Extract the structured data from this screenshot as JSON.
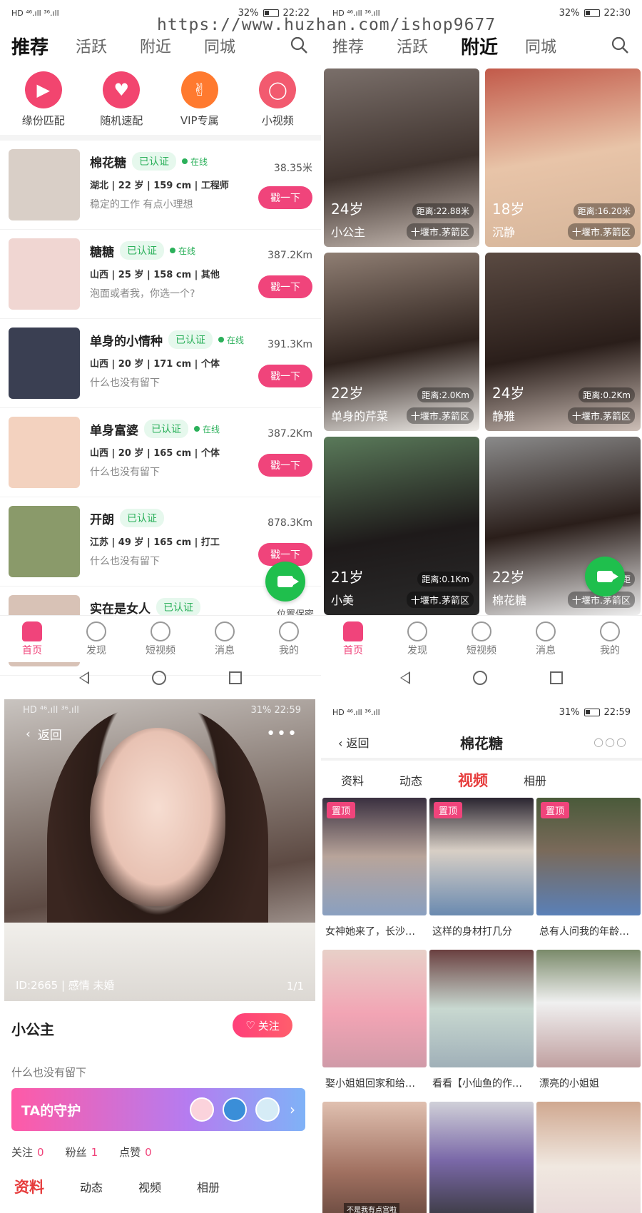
{
  "watermark": "https://www.huzhan.com/ishop9677",
  "colors": {
    "accent": "#f0447b",
    "online": "#2bb05a",
    "tab_active": "#e63c3c",
    "fab": "#1fbf4d"
  },
  "recommend": {
    "status": {
      "signal": "HD ⁴⁶.ıll ³⁶.ıll",
      "battery": "32%",
      "time": "22:22"
    },
    "tabs": [
      "推荐",
      "活跃",
      "附近",
      "同城"
    ],
    "active_tab": 0,
    "features": [
      {
        "label": "缘份匹配",
        "icon": "video-camera-icon",
        "color": "#f2456f"
      },
      {
        "label": "随机速配",
        "icon": "heart-target-icon",
        "color": "#f2456f"
      },
      {
        "label": "VIP专属",
        "icon": "thumbs-up-icon",
        "color": "#ff7a2f"
      },
      {
        "label": "小视频",
        "icon": "chat-bubble-icon",
        "color": "#f25a6f"
      }
    ],
    "users": [
      {
        "name": "棉花糖",
        "verified": "已认证",
        "online": "在线",
        "detail": "湖北 | 22 岁 | 159 cm | 工程师",
        "bio": "稳定的工作 有点小理想",
        "distance": "38.35米",
        "poke": "戳一下"
      },
      {
        "name": "糖糖",
        "verified": "已认证",
        "online": "在线",
        "detail": "山西 | 25 岁 | 158 cm | 其他",
        "bio": "泡面或者我，你选一个?",
        "distance": "387.2Km",
        "poke": "戳一下"
      },
      {
        "name": "单身的小情种",
        "verified": "已认证",
        "online": "在线",
        "detail": "山西 | 20 岁 | 171 cm | 个体",
        "bio": "什么也没有留下",
        "distance": "391.3Km",
        "poke": "戳一下"
      },
      {
        "name": "单身富婆",
        "verified": "已认证",
        "online": "在线",
        "detail": "山西 | 20 岁 | 165 cm | 个体",
        "bio": "什么也没有留下",
        "distance": "387.2Km",
        "poke": "戳一下"
      },
      {
        "name": "开朗",
        "verified": "已认证",
        "online": "",
        "detail": "江苏 | 49 岁 | 165 cm | 打工",
        "bio": "什么也没有留下",
        "distance": "878.3Km",
        "poke": "戳一下"
      },
      {
        "name": "实在是女人",
        "verified": "已认证",
        "online": "",
        "detail": "",
        "bio": "",
        "distance": "",
        "poke": ""
      }
    ],
    "location_note": "位置保密",
    "bottom_nav": [
      "首页",
      "发现",
      "短视频",
      "消息",
      "我的"
    ]
  },
  "nearby": {
    "status": {
      "signal": "HD ⁴⁶.ıll ³⁶.ıll",
      "battery": "32%",
      "time": "22:30"
    },
    "tabs": [
      "推荐",
      "活跃",
      "附近",
      "同城"
    ],
    "active_tab": 2,
    "cards": [
      {
        "age": "24岁",
        "distance": "距离:22.88米",
        "name": "小公主",
        "city": "十堰市.茅箭区"
      },
      {
        "age": "18岁",
        "distance": "距离:16.20米",
        "name": "沉静",
        "city": "十堰市.茅箭区"
      },
      {
        "age": "22岁",
        "distance": "距离:2.0Km",
        "name": "单身的芹菜",
        "city": "十堰市.茅箭区"
      },
      {
        "age": "24岁",
        "distance": "距离:0.2Km",
        "name": "静雅",
        "city": "十堰市.茅箭区"
      },
      {
        "age": "21岁",
        "distance": "距离:0.1Km",
        "name": "小美",
        "city": "十堰市.茅箭区"
      },
      {
        "age": "22岁",
        "distance": "距",
        "name": "棉花糖",
        "city": "十堰市.茅箭区"
      }
    ],
    "bottom_nav": [
      "首页",
      "发现",
      "短视频",
      "消息",
      "我的"
    ]
  },
  "profile": {
    "status": {
      "signal": "HD ⁴⁶.ıll ³⁶.ıll",
      "battery": "31%",
      "time": "22:59"
    },
    "back": "返回",
    "meta": "ID:2665 | 感情 未婚",
    "pager": "1/1",
    "name": "小公主",
    "follow": "关注",
    "bio": "什么也没有留下",
    "guard_title": "TA的守护",
    "stats": [
      {
        "label": "关注",
        "value": "0"
      },
      {
        "label": "粉丝",
        "value": "1"
      },
      {
        "label": "点赞",
        "value": "0"
      }
    ],
    "tabs": [
      "资料",
      "动态",
      "视频",
      "相册"
    ],
    "active_tab": 0
  },
  "videos": {
    "status": {
      "signal": "HD ⁴⁶.ıll ³⁶.ıll",
      "battery": "31%",
      "time": "22:59"
    },
    "back": "返回",
    "title": "棉花糖",
    "tabs": [
      "资料",
      "动态",
      "视频",
      "相册"
    ],
    "active_tab": 2,
    "items": [
      {
        "title": "女神她来了，长沙…",
        "pin": "置顶"
      },
      {
        "title": "这样的身材打几分",
        "pin": "置顶"
      },
      {
        "title": "总有人问我的年龄…",
        "pin": "置顶"
      },
      {
        "title": "娶小姐姐回家和给…",
        "pin": ""
      },
      {
        "title": "看看【小仙鱼的作…",
        "pin": ""
      },
      {
        "title": "漂亮的小姐姐",
        "pin": ""
      },
      {
        "title": "",
        "pin": "",
        "caption": "不是我有点宫啦"
      },
      {
        "title": "",
        "pin": ""
      },
      {
        "title": "",
        "pin": ""
      }
    ]
  }
}
